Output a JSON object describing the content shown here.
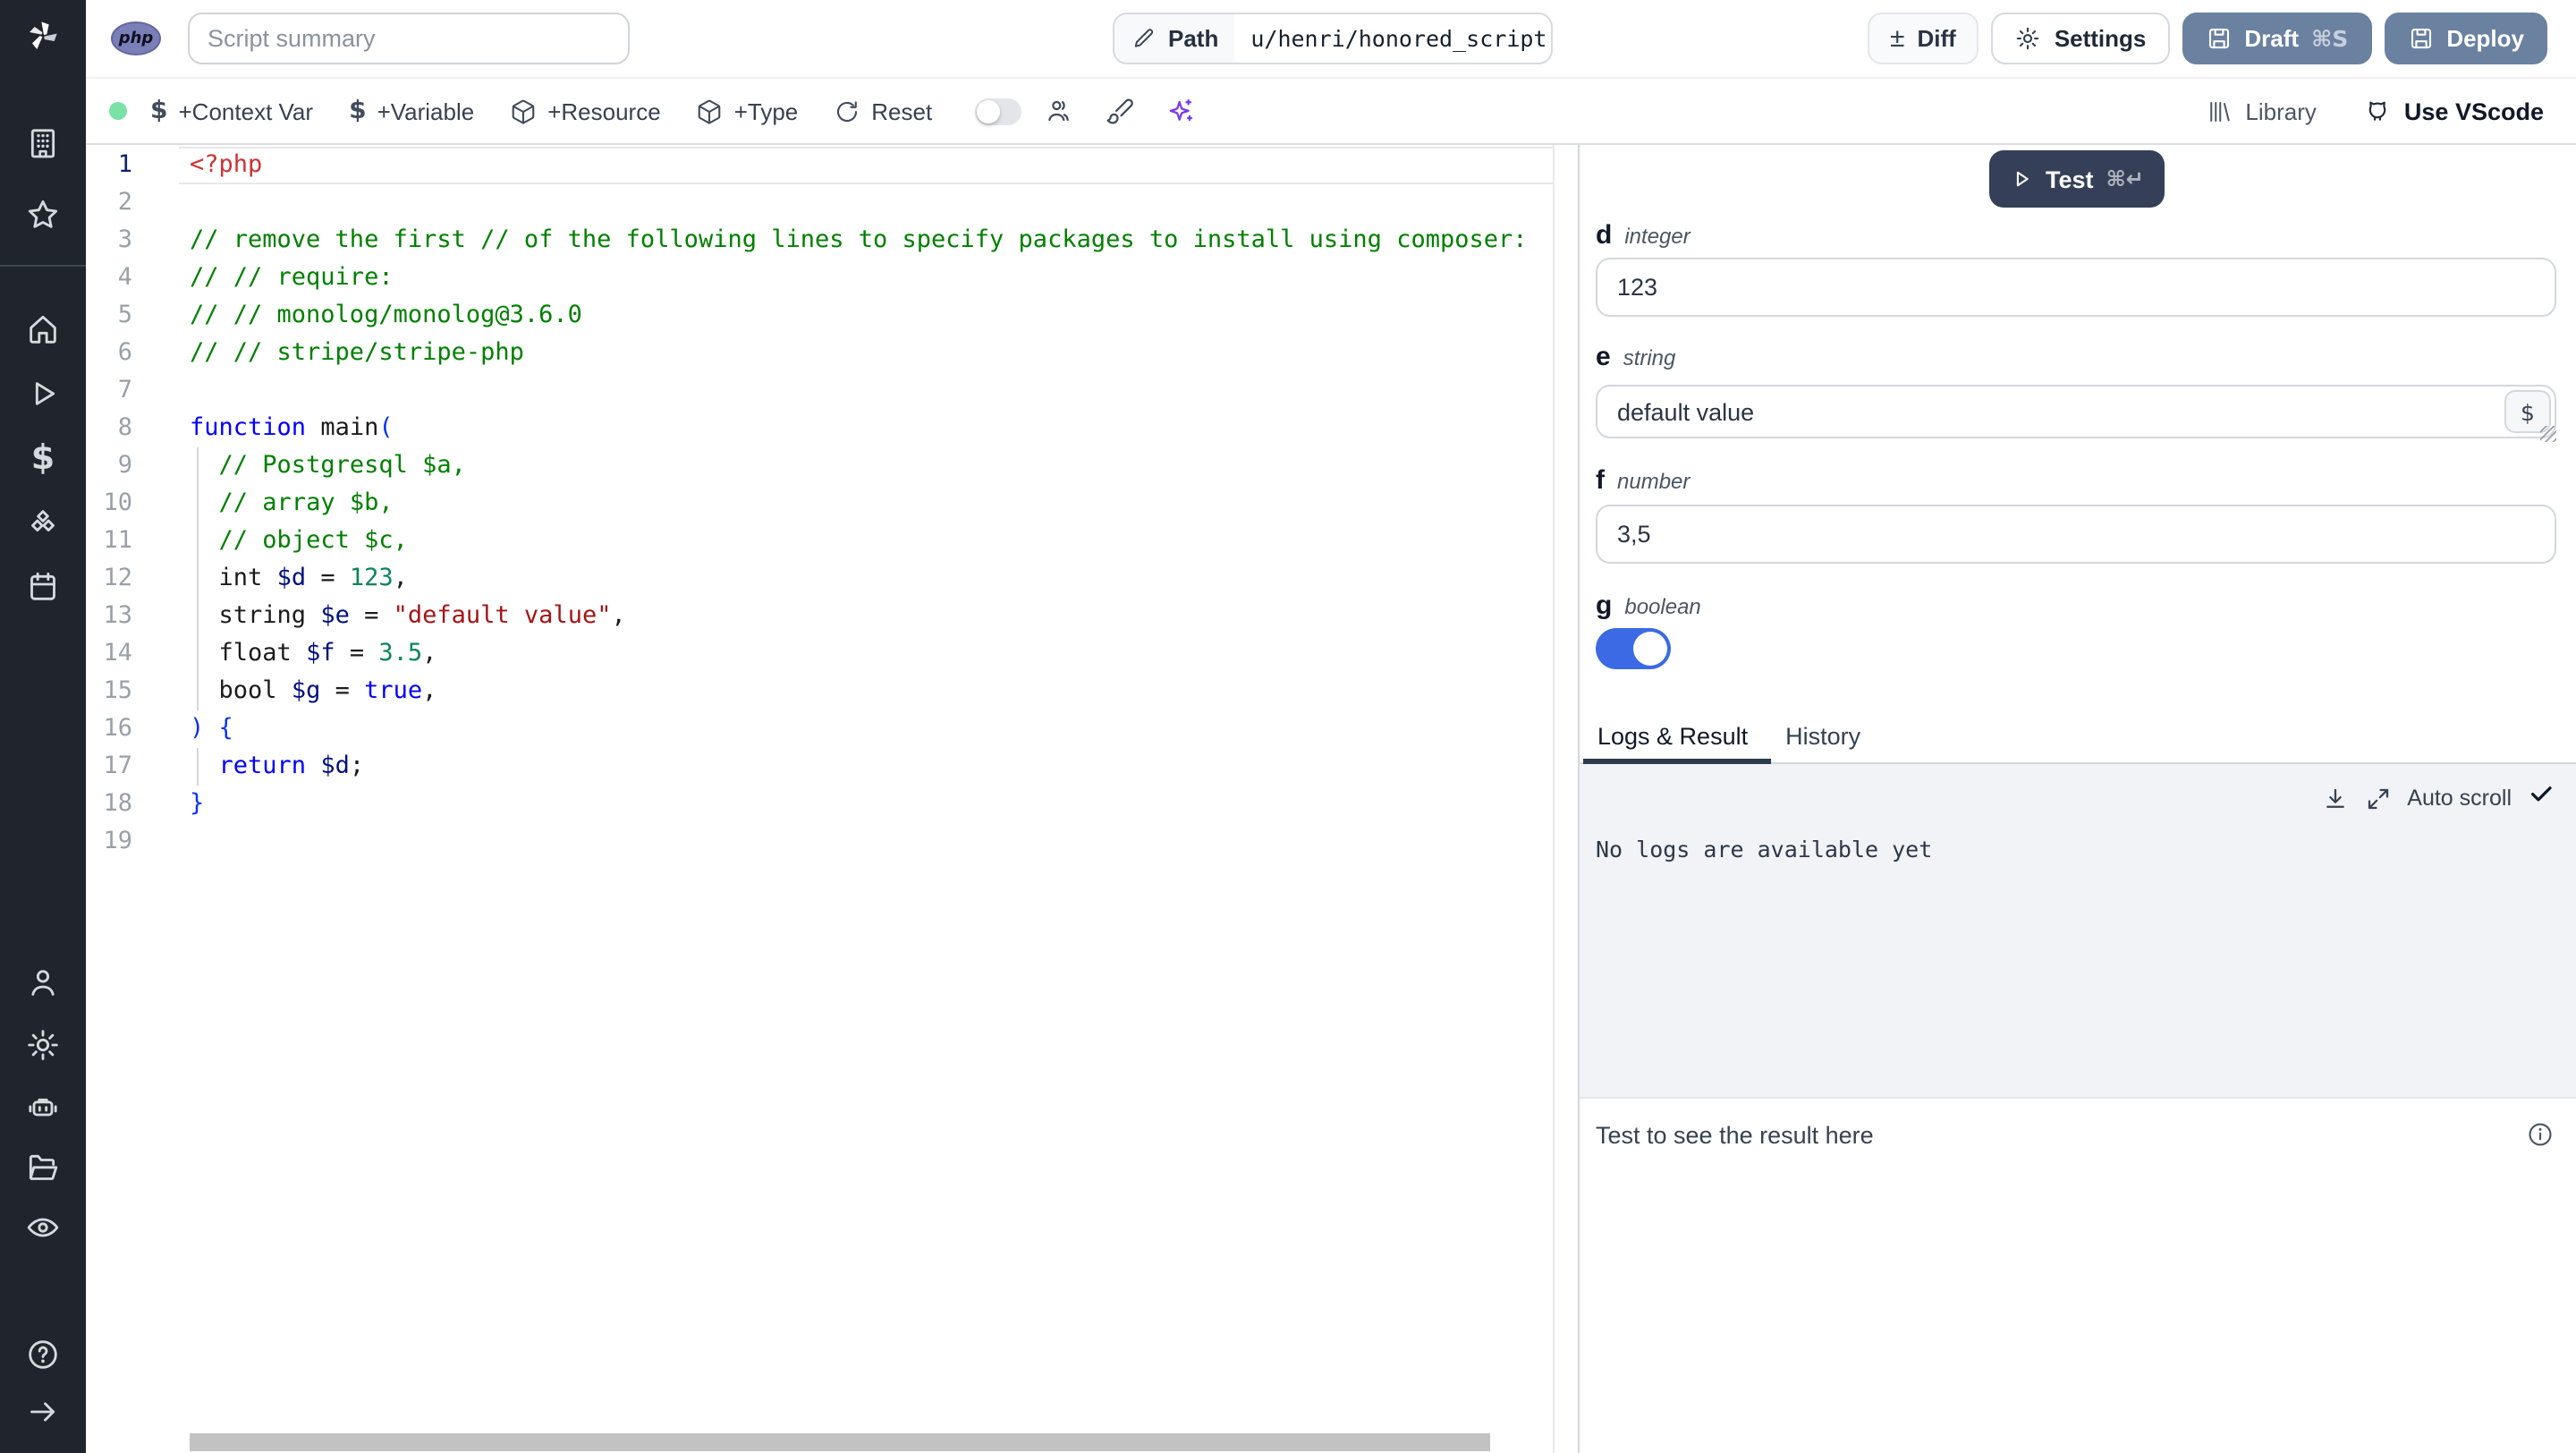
{
  "topbar": {
    "language_badge": "php",
    "summary_placeholder": "Script summary",
    "path_label": "Path",
    "path_value": "u/henri/honored_script",
    "diff_label": "Diff",
    "settings_label": "Settings",
    "draft_label": "Draft",
    "draft_shortcut": "⌘S",
    "deploy_label": "Deploy",
    "action_button_color": "#6a81a0"
  },
  "toolbar": {
    "status_dot_color": "#79e2a4",
    "context_var_label": "+Context Var",
    "variable_label": "+Variable",
    "resource_label": "+Resource",
    "type_label": "+Type",
    "reset_label": "Reset",
    "assistant_toggle_on": false,
    "library_label": "Library",
    "vscode_label": "Use VScode",
    "sparkles_color": "#7c3aed"
  },
  "sidebar": {
    "items": [
      "workspace",
      "favorites",
      "home",
      "runs",
      "variables",
      "resources",
      "schedules",
      "account",
      "settings",
      "workers",
      "folders",
      "audit-logs",
      "help",
      "expand"
    ]
  },
  "editor": {
    "active_line": 1,
    "token_colors": {
      "tag": "#cd3333",
      "comment": "#008000",
      "keyword": "#0000ff",
      "variable": "#001080",
      "number": "#098658",
      "string": "#a31515",
      "bracket": "#0431fa",
      "plain": "#1b1b1b"
    },
    "lines": [
      [
        [
          "<?php",
          "tag"
        ]
      ],
      [],
      [
        [
          "// remove the first // of the following lines to specify packages to install using composer:",
          "comment"
        ]
      ],
      [
        [
          "// // require:",
          "comment"
        ]
      ],
      [
        [
          "// // monolog/monolog@3.6.0",
          "comment"
        ]
      ],
      [
        [
          "// // stripe/stripe-php",
          "comment"
        ]
      ],
      [],
      [
        [
          "function",
          "keyword"
        ],
        [
          " main",
          "plain"
        ],
        [
          "(",
          "bracket"
        ]
      ],
      [
        [
          "  ",
          "plain"
        ],
        [
          "// Postgresql $a,",
          "comment"
        ]
      ],
      [
        [
          "  ",
          "plain"
        ],
        [
          "// array $b,",
          "comment"
        ]
      ],
      [
        [
          "  ",
          "plain"
        ],
        [
          "// object $c,",
          "comment"
        ]
      ],
      [
        [
          "  int ",
          "plain"
        ],
        [
          "$d",
          "variable"
        ],
        [
          " = ",
          "plain"
        ],
        [
          "123",
          "number"
        ],
        [
          ",",
          "plain"
        ]
      ],
      [
        [
          "  string ",
          "plain"
        ],
        [
          "$e",
          "variable"
        ],
        [
          " = ",
          "plain"
        ],
        [
          "\"default value\"",
          "string"
        ],
        [
          ",",
          "plain"
        ]
      ],
      [
        [
          "  float ",
          "plain"
        ],
        [
          "$f",
          "variable"
        ],
        [
          " = ",
          "plain"
        ],
        [
          "3.5",
          "number"
        ],
        [
          ",",
          "plain"
        ]
      ],
      [
        [
          "  bool ",
          "plain"
        ],
        [
          "$g",
          "variable"
        ],
        [
          " = ",
          "plain"
        ],
        [
          "true",
          "keyword"
        ],
        [
          ",",
          "plain"
        ]
      ],
      [
        [
          ") {",
          "bracket"
        ]
      ],
      [
        [
          "  ",
          "plain"
        ],
        [
          "return",
          "keyword"
        ],
        [
          " ",
          "plain"
        ],
        [
          "$d",
          "variable"
        ],
        [
          ";",
          "plain"
        ]
      ],
      [
        [
          "}",
          "bracket"
        ]
      ],
      []
    ]
  },
  "panel": {
    "test_button": {
      "label": "Test",
      "shortcut": "⌘↵",
      "color": "#353f58"
    },
    "fields": [
      {
        "name": "d",
        "type": "integer",
        "value": "123"
      },
      {
        "name": "e",
        "type": "string",
        "value": "default value",
        "var_button": "$"
      },
      {
        "name": "f",
        "type": "number",
        "value": "3,5"
      },
      {
        "name": "g",
        "type": "boolean",
        "value": true,
        "toggle_color": "#3b6ae4"
      }
    ],
    "tabs": [
      {
        "label": "Logs & Result",
        "active": true
      },
      {
        "label": "History",
        "active": false
      }
    ],
    "autoscroll_label": "Auto scroll",
    "logs_empty_text": "No logs are available yet",
    "result_placeholder": "Test to see the result here"
  }
}
